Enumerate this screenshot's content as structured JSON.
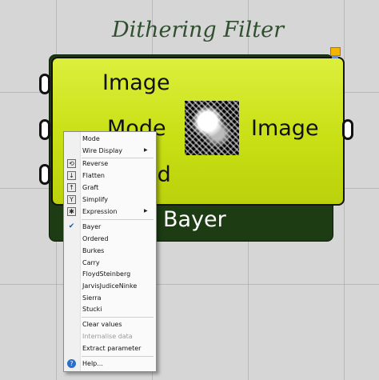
{
  "component": {
    "title": "Dithering Filter",
    "nickname": "Bayer",
    "inputs": [
      "Image",
      "Mode",
      "ed"
    ],
    "output": "Image"
  },
  "colors": {
    "body": "#c8e014",
    "frame": "#1d3c13",
    "flag": "#f4b400"
  },
  "menu": {
    "items": [
      {
        "label": "Mode",
        "icon": "",
        "submenu": false
      },
      {
        "label": "Wire Display",
        "icon": "",
        "submenu": true
      },
      {
        "label": "Reverse",
        "icon": "reverse-icon",
        "submenu": false
      },
      {
        "label": "Flatten",
        "icon": "flatten-icon",
        "submenu": false
      },
      {
        "label": "Graft",
        "icon": "graft-icon",
        "submenu": false
      },
      {
        "label": "Simplify",
        "icon": "simplify-icon",
        "submenu": false
      },
      {
        "label": "Expression",
        "icon": "expression-icon",
        "submenu": true
      },
      {
        "label": "Bayer",
        "icon": "checkmark-icon",
        "checked": true
      },
      {
        "label": "Ordered"
      },
      {
        "label": "Burkes"
      },
      {
        "label": "Carry"
      },
      {
        "label": "FloydSteinberg"
      },
      {
        "label": "JarvisJudiceNinke"
      },
      {
        "label": "Sierra"
      },
      {
        "label": "Stucki"
      },
      {
        "label": "Clear values"
      },
      {
        "label": "Internalise data",
        "disabled": true
      },
      {
        "label": "Extract parameter"
      },
      {
        "label": "Help...",
        "icon": "help-icon"
      }
    ]
  }
}
